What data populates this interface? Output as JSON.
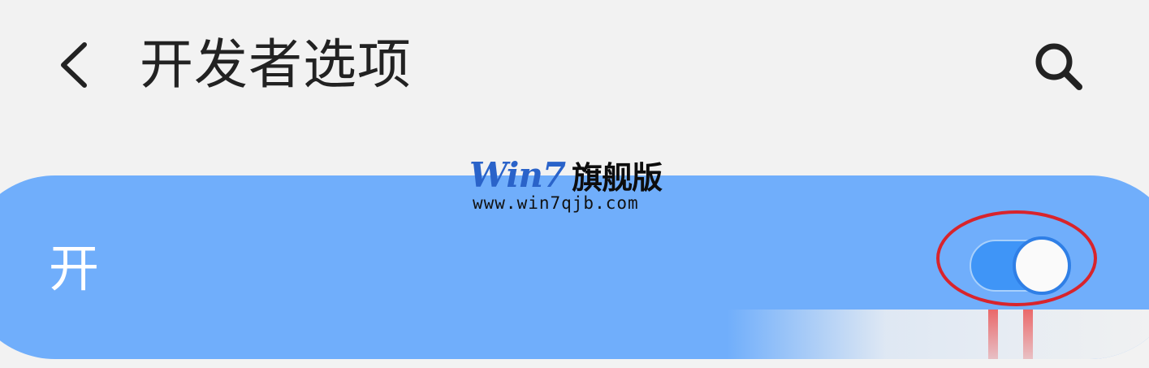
{
  "header": {
    "title": "开发者选项",
    "back_icon": "chevron-left-icon",
    "search_icon": "search-icon"
  },
  "watermark": {
    "brand": "Win7",
    "brand_cn": "旗舰版",
    "url": "www.win7qjb.com"
  },
  "master_switch": {
    "label": "开",
    "state": "on"
  },
  "colors": {
    "background": "#f2f2f2",
    "card": "#70aefb",
    "toggle_track": "#3f95f7",
    "toggle_thumb_border": "#2f7fe6",
    "highlight": "#d8242c",
    "title_text": "#222222"
  }
}
